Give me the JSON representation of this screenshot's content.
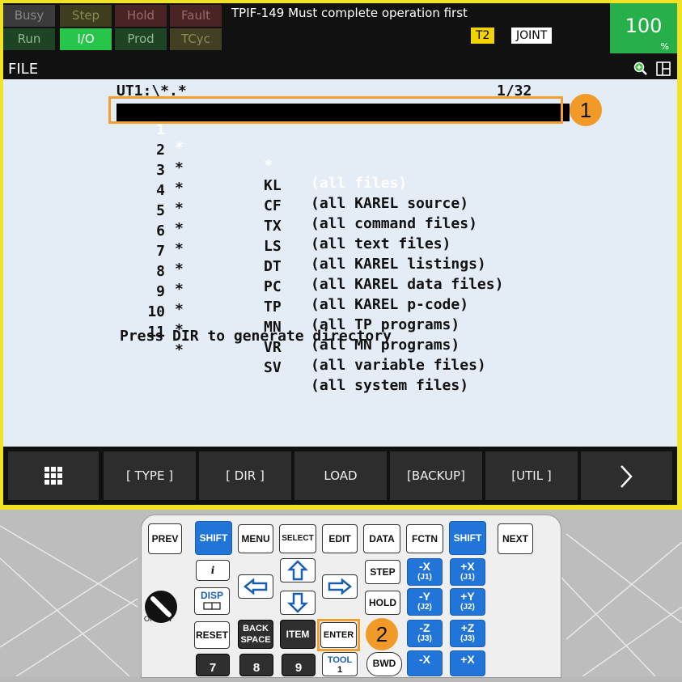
{
  "status": {
    "row1": [
      "Busy",
      "Step",
      "Hold",
      "Fault"
    ],
    "row2": [
      "Run",
      "I/O",
      "Prod",
      "TCyc"
    ]
  },
  "alarm": {
    "message": "TPIF-149 Must complete operation first",
    "mode": "T2",
    "coord": "JOINT"
  },
  "override": {
    "value": "100",
    "unit": "%"
  },
  "title": "FILE",
  "directory": {
    "path": "UT1:\\*.*",
    "page": "1/32",
    "rows": [
      {
        "no": "1",
        "star": "*",
        "ext": "*",
        "desc": "(all files)"
      },
      {
        "no": "2",
        "star": "*",
        "ext": "KL",
        "desc": "(all KAREL source)"
      },
      {
        "no": "3",
        "star": "*",
        "ext": "CF",
        "desc": "(all command files)"
      },
      {
        "no": "4",
        "star": "*",
        "ext": "TX",
        "desc": "(all text files)"
      },
      {
        "no": "5",
        "star": "*",
        "ext": "LS",
        "desc": "(all KAREL listings)"
      },
      {
        "no": "6",
        "star": "*",
        "ext": "DT",
        "desc": "(all KAREL data files)"
      },
      {
        "no": "7",
        "star": "*",
        "ext": "PC",
        "desc": "(all KAREL p-code)"
      },
      {
        "no": "8",
        "star": "*",
        "ext": "TP",
        "desc": "(all TP programs)"
      },
      {
        "no": "9",
        "star": "*",
        "ext": "MN",
        "desc": "(all MN programs)"
      },
      {
        "no": "10",
        "star": "*",
        "ext": "VR",
        "desc": "(all variable files)"
      },
      {
        "no": "11",
        "star": "*",
        "ext": "SV",
        "desc": "(all system files)"
      }
    ],
    "hint": "Press DIR to generate directory"
  },
  "callouts": [
    "1",
    "2"
  ],
  "fkeys": [
    "[ TYPE ]",
    "[ DIR ]",
    "LOAD",
    "[BACKUP]",
    "[UTIL ]"
  ],
  "keypad": {
    "prev": "PREV",
    "shift": "SHIFT",
    "menu": "MENU",
    "select": "SELECT",
    "edit": "EDIT",
    "data": "DATA",
    "fctn": "FCTN",
    "next": "NEXT",
    "info": "i",
    "disp": "DISP",
    "step": "STEP",
    "hold": "HOLD",
    "reset": "RESET",
    "back1": "BACK",
    "back2": "SPACE",
    "item": "ITEM",
    "enter": "ENTER",
    "tool": "TOOL",
    "tool_num": "1",
    "bwd": "BWD",
    "k7": "7",
    "k8": "8",
    "k9": "9",
    "jog": [
      {
        "axis": "-X",
        "joint": "(J1)"
      },
      {
        "axis": "+X",
        "joint": "(J1)"
      },
      {
        "axis": "-Y",
        "joint": "(J2)"
      },
      {
        "axis": "+Y",
        "joint": "(J2)"
      },
      {
        "axis": "-Z",
        "joint": "(J3)"
      },
      {
        "axis": "+Z",
        "joint": "(J3)"
      },
      {
        "axis": "-X",
        "joint": ""
      },
      {
        "axis": "+X",
        "joint": ""
      }
    ],
    "knob_label": "OFF  ON"
  }
}
